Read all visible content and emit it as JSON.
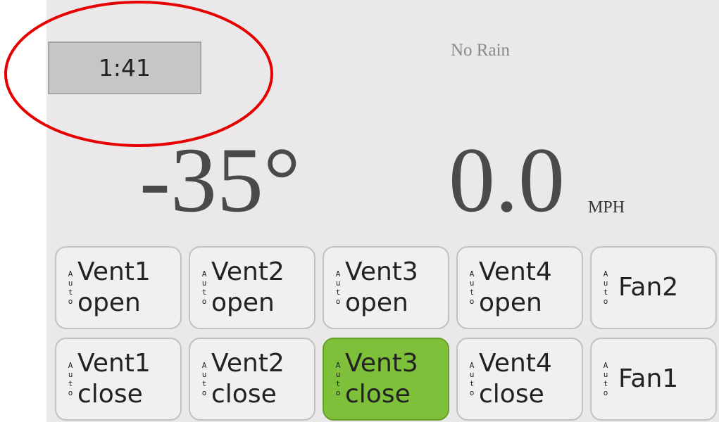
{
  "clock": {
    "time": "1:41"
  },
  "weather": {
    "rain_status": "No Rain",
    "temperature": "-35°",
    "wind_speed": "0.0",
    "wind_unit": "MPH"
  },
  "auto_letters": [
    "A",
    "u",
    "t",
    "o"
  ],
  "buttons_top": [
    {
      "line1": "Vent1",
      "line2": "open",
      "active": false
    },
    {
      "line1": "Vent2",
      "line2": "open",
      "active": false
    },
    {
      "line1": "Vent3",
      "line2": "open",
      "active": false
    },
    {
      "line1": "Vent4",
      "line2": "open",
      "active": false
    },
    {
      "line1": "Fan2",
      "line2": "",
      "active": false
    }
  ],
  "buttons_bottom": [
    {
      "line1": "Vent1",
      "line2": "close",
      "active": false
    },
    {
      "line1": "Vent2",
      "line2": "close",
      "active": false
    },
    {
      "line1": "Vent3",
      "line2": "close",
      "active": true
    },
    {
      "line1": "Vent4",
      "line2": "close",
      "active": false
    },
    {
      "line1": "Fan1",
      "line2": "",
      "active": false
    }
  ],
  "colors": {
    "active_button": "#7fc03a",
    "highlight_ellipse": "#e60000",
    "panel_background": "#ebe8ea"
  }
}
